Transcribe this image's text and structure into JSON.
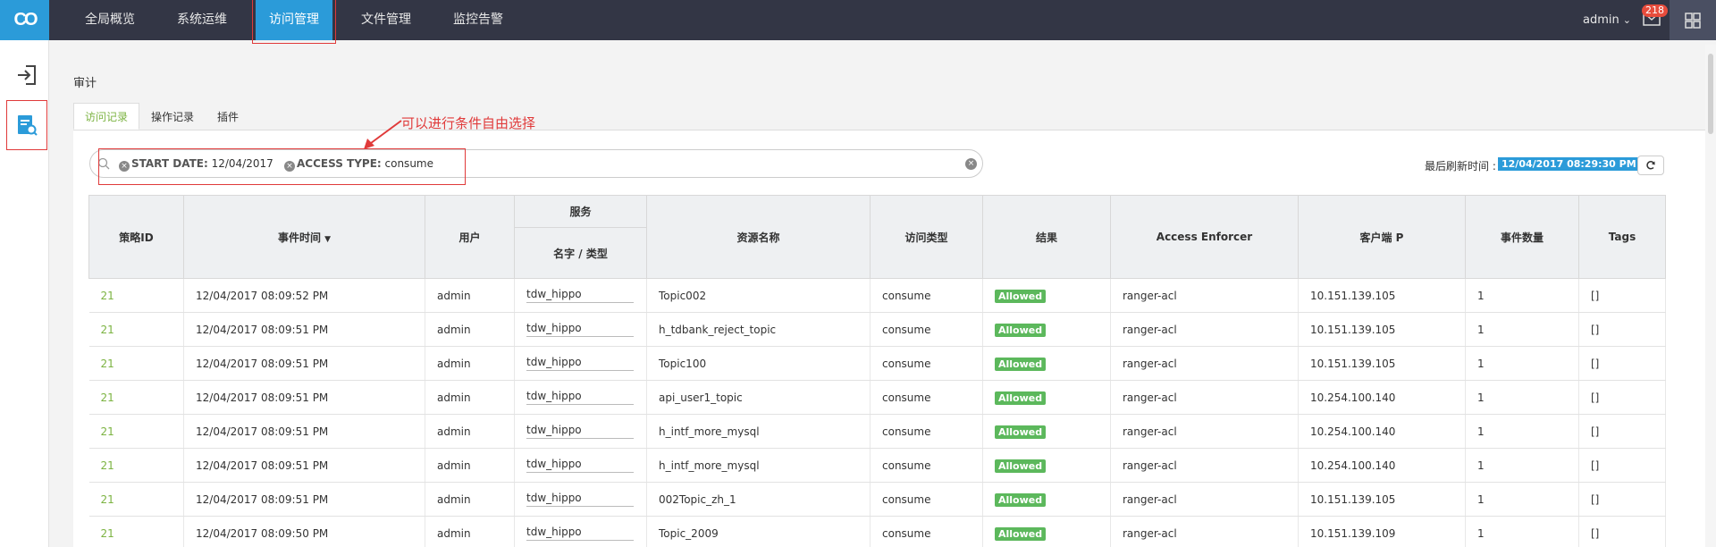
{
  "app": {
    "logo_text": "CO",
    "accent": "#2b9bd9"
  },
  "topnav": {
    "items": [
      {
        "label": "全局概览"
      },
      {
        "label": "系统运维"
      },
      {
        "label": "访问管理",
        "active": true
      },
      {
        "label": "文件管理"
      },
      {
        "label": "监控告警"
      }
    ]
  },
  "user": {
    "name": "admin",
    "notification_count": "218"
  },
  "sidebar": {
    "icons": [
      "sign-in-icon",
      "audit-search-icon"
    ]
  },
  "page": {
    "title": "审计"
  },
  "tabs": [
    {
      "label": "访问记录",
      "active": true
    },
    {
      "label": "操作记录"
    },
    {
      "label": "插件"
    }
  ],
  "search": {
    "facets": [
      {
        "key": "START DATE:",
        "value": "12/04/2017"
      },
      {
        "key": "ACCESS TYPE:",
        "value": "consume"
      }
    ]
  },
  "annotation": {
    "text": "可以进行条件自由选择"
  },
  "refresh": {
    "label": "最后刷新时间 :",
    "time": "12/04/2017 08:29:30 PM"
  },
  "table": {
    "group_header": "服务",
    "columns": {
      "policy_id": "策略ID",
      "event_time": "事件时间",
      "user": "用户",
      "service_name_type": "名字 / 类型",
      "resource_name": "资源名称",
      "access_type": "访问类型",
      "result": "结果",
      "access_enforcer": "Access Enforcer",
      "client_ip": "客户端 P",
      "event_count": "事件数量",
      "tags": "Tags"
    },
    "rows": [
      {
        "policy_id": "21",
        "event_time": "12/04/2017 08:09:52 PM",
        "user": "admin",
        "service": "tdw_hippo",
        "resource": "Topic002",
        "access_type": "consume",
        "result": "Allowed",
        "enforcer": "ranger-acl",
        "client_ip": "10.151.139.105",
        "count": "1",
        "tags": "[]"
      },
      {
        "policy_id": "21",
        "event_time": "12/04/2017 08:09:51 PM",
        "user": "admin",
        "service": "tdw_hippo",
        "resource": "h_tdbank_reject_topic",
        "access_type": "consume",
        "result": "Allowed",
        "enforcer": "ranger-acl",
        "client_ip": "10.151.139.105",
        "count": "1",
        "tags": "[]"
      },
      {
        "policy_id": "21",
        "event_time": "12/04/2017 08:09:51 PM",
        "user": "admin",
        "service": "tdw_hippo",
        "resource": "Topic100",
        "access_type": "consume",
        "result": "Allowed",
        "enforcer": "ranger-acl",
        "client_ip": "10.151.139.105",
        "count": "1",
        "tags": "[]"
      },
      {
        "policy_id": "21",
        "event_time": "12/04/2017 08:09:51 PM",
        "user": "admin",
        "service": "tdw_hippo",
        "resource": "api_user1_topic",
        "access_type": "consume",
        "result": "Allowed",
        "enforcer": "ranger-acl",
        "client_ip": "10.254.100.140",
        "count": "1",
        "tags": "[]"
      },
      {
        "policy_id": "21",
        "event_time": "12/04/2017 08:09:51 PM",
        "user": "admin",
        "service": "tdw_hippo",
        "resource": "h_intf_more_mysql",
        "access_type": "consume",
        "result": "Allowed",
        "enforcer": "ranger-acl",
        "client_ip": "10.254.100.140",
        "count": "1",
        "tags": "[]"
      },
      {
        "policy_id": "21",
        "event_time": "12/04/2017 08:09:51 PM",
        "user": "admin",
        "service": "tdw_hippo",
        "resource": "h_intf_more_mysql",
        "access_type": "consume",
        "result": "Allowed",
        "enforcer": "ranger-acl",
        "client_ip": "10.254.100.140",
        "count": "1",
        "tags": "[]"
      },
      {
        "policy_id": "21",
        "event_time": "12/04/2017 08:09:51 PM",
        "user": "admin",
        "service": "tdw_hippo",
        "resource": "002Topic_zh_1",
        "access_type": "consume",
        "result": "Allowed",
        "enforcer": "ranger-acl",
        "client_ip": "10.151.139.105",
        "count": "1",
        "tags": "[]"
      },
      {
        "policy_id": "21",
        "event_time": "12/04/2017 08:09:50 PM",
        "user": "admin",
        "service": "tdw_hippo",
        "resource": "Topic_2009",
        "access_type": "consume",
        "result": "Allowed",
        "enforcer": "ranger-acl",
        "client_ip": "10.151.139.109",
        "count": "1",
        "tags": "[]"
      }
    ]
  }
}
